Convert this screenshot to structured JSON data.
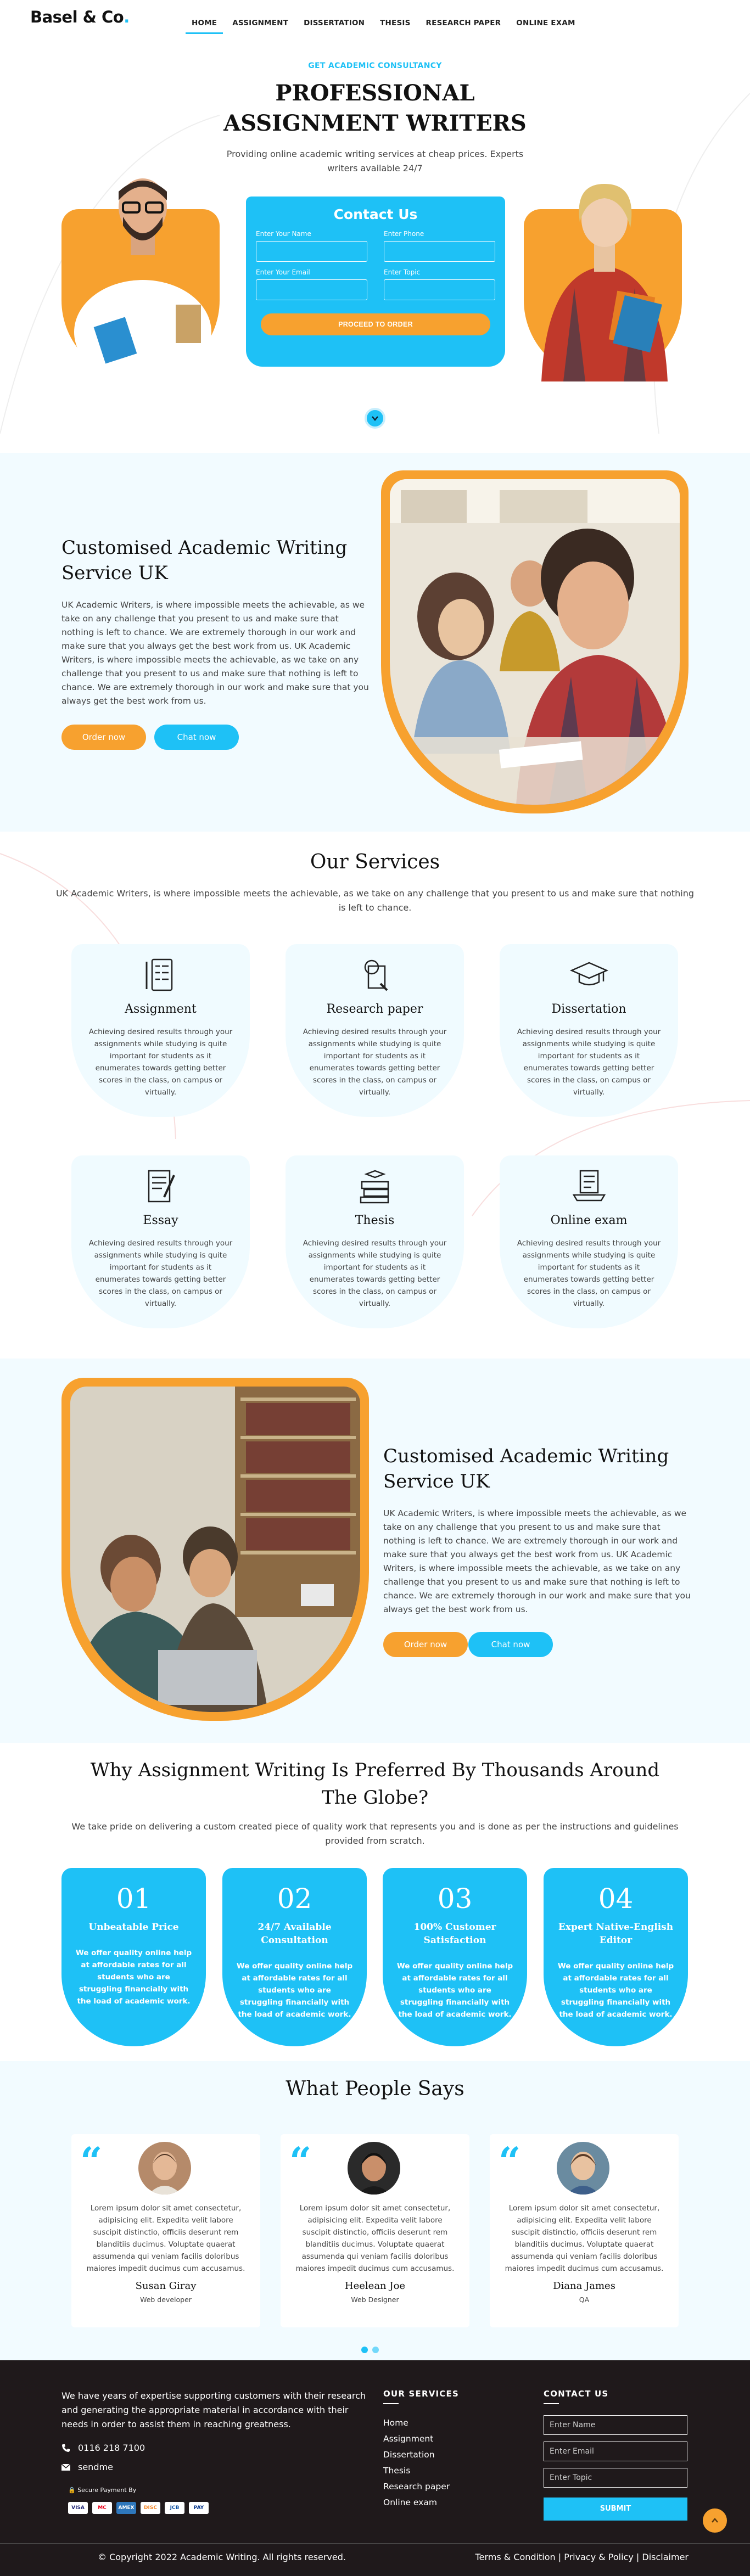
{
  "brand": {
    "name": "Basel & Co",
    "dot": "."
  },
  "nav": [
    {
      "label": "HOME",
      "active": true
    },
    {
      "label": "ASSIGNMENT"
    },
    {
      "label": "DISSERTATION"
    },
    {
      "label": "THESIS"
    },
    {
      "label": "RESEARCH PAPER"
    },
    {
      "label": "ONLINE EXAM"
    }
  ],
  "hero": {
    "tag": "GET ACADEMIC CONSULTANCY",
    "title_line1": "PROFESSIONAL",
    "title_line2": "ASSIGNMENT WRITERS",
    "subtitle": "Providing online academic writing services at cheap prices. Experts writers available 24/7",
    "contact": {
      "title": "Contact Us",
      "name_label": "Enter Your Name",
      "phone_label": "Enter Phone",
      "email_label": "Enter Your Email",
      "topic_label": "Enter Topic",
      "button": "PROCEED TO ORDER"
    }
  },
  "about1": {
    "title": "Customised Academic Writing Service UK",
    "text": "UK Academic Writers, is where impossible meets the achievable, as we take on any challenge that you present to us and make sure that nothing is left to chance. We are extremely thorough in our work and make sure that you always get the best work from us. UK Academic Writers, is where impossible meets the achievable, as we take on any challenge that you present to us and make sure that nothing is left to chance. We are extremely thorough in our work and make sure that you always get the best work from us.",
    "order_btn": "Order now",
    "chat_btn": "Chat now"
  },
  "services": {
    "title": "Our Services",
    "subtitle": "UK Academic Writers, is where impossible meets the achievable, as we take on any challenge that you present to us and make sure that nothing is left to chance.",
    "items": [
      {
        "title": "Assignment",
        "icon": "checklist-icon",
        "text": "Achieving desired results through your assignments while studying is quite important for students as it enumerates towards getting better scores in the class, on campus or virtually."
      },
      {
        "title": "Research paper",
        "icon": "magnifier-paper-icon",
        "text": "Achieving desired results through your assignments while studying is quite important for students as it enumerates towards getting better scores in the class, on campus or virtually."
      },
      {
        "title": "Dissertation",
        "icon": "graduation-cap-icon",
        "text": "Achieving desired results through your assignments while studying is quite important for students as it enumerates towards getting better scores in the class, on campus or virtually."
      },
      {
        "title": "Essay",
        "icon": "essay-pen-icon",
        "text": "Achieving desired results through your assignments while studying is quite important for students as it enumerates towards getting better scores in the class, on campus or virtually."
      },
      {
        "title": "Thesis",
        "icon": "book-stack-icon",
        "text": "Achieving desired results through your assignments while studying is quite important for students as it enumerates towards getting better scores in the class, on campus or virtually."
      },
      {
        "title": "Online exam",
        "icon": "laptop-exam-icon",
        "text": "Achieving desired results through your assignments while studying is quite important for students as it enumerates towards getting better scores in the class, on campus or virtually."
      }
    ]
  },
  "about2": {
    "title": "Customised Academic Writing Service UK",
    "text": "UK Academic Writers, is where impossible meets the achievable, as we take on any challenge that you present to us and make sure that nothing is left to chance. We are extremely thorough in our work and make sure that you always get the best work from us. UK Academic Writers, is where impossible meets the achievable, as we take on any challenge that you present to us and make sure that nothing is left to chance. We are extremely thorough in our work and make sure that you always get the best work from us.",
    "order_btn": "Order now",
    "chat_btn": "Chat now"
  },
  "why": {
    "title": "Why Assignment Writing Is Preferred By Thousands Around The Globe?",
    "subtitle": "We take pride on delivering a custom created piece of quality work that represents you and is done as per the instructions and guidelines provided from scratch.",
    "items": [
      {
        "num": "01",
        "title": "Unbeatable Price",
        "text": "We offer quality online help at affordable rates for all students who are struggling financially with the load of academic work."
      },
      {
        "num": "02",
        "title": "24/7 Available Consultation",
        "text": "We offer quality online help at affordable rates for all students who are struggling financially with the load of academic work."
      },
      {
        "num": "03",
        "title": "100% Customer Satisfaction",
        "text": "We offer quality online help at affordable rates for all students who are struggling financially with the load of academic work."
      },
      {
        "num": "04",
        "title": "Expert Native-English Editor",
        "text": "We offer quality online help at affordable rates for all students who are struggling financially with the load of academic work."
      }
    ]
  },
  "testimonials": {
    "title": "What People Says",
    "items": [
      {
        "text": "Lorem ipsum dolor sit amet consectetur, adipisicing elit. Expedita velit labore suscipit distinctio, officiis deserunt rem blanditiis ducimus. Voluptate quaerat assumenda qui veniam facilis doloribus maiores impedit ducimus cum accusamus.",
        "name": "Susan Giray",
        "role": "Web developer"
      },
      {
        "text": "Lorem ipsum dolor sit amet consectetur, adipisicing elit. Expedita velit labore suscipit distinctio, officiis deserunt rem blanditiis ducimus. Voluptate quaerat assumenda qui veniam facilis doloribus maiores impedit ducimus cum accusamus.",
        "name": "Heelean Joe",
        "role": "Web Designer"
      },
      {
        "text": "Lorem ipsum dolor sit amet consectetur, adipisicing elit. Expedita velit labore suscipit distinctio, officiis deserunt rem blanditiis ducimus. Voluptate quaerat assumenda qui veniam facilis doloribus maiores impedit ducimus cum accusamus.",
        "name": "Diana James",
        "role": "QA"
      }
    ]
  },
  "footer": {
    "about": "We have years of expertise supporting customers with their research and generating the appropriate material in accordance with their needs in order to assist them in reaching greatness.",
    "phone": "0116 218 7100",
    "email": "sendme",
    "secure": "Secure Payment By",
    "cards": [
      "VISA",
      "MC",
      "AMEX",
      "DISC",
      "JCB",
      "PAY"
    ],
    "services_title": "OUR SERVICES",
    "links": [
      "Home",
      "Assignment",
      "Dissertation",
      "Thesis",
      "Research paper",
      "Online exam"
    ],
    "contact_title": "CONTACT US",
    "inputs": [
      "Enter Name",
      "Enter Email",
      "Enter Topic"
    ],
    "submit": "SUBMIT",
    "copyright": "© Copyright 2022 Academic Writing. All rights reserved.",
    "legal": "Terms & Condition | Privacy & Policy | Disclaimer"
  },
  "colors": {
    "accent": "#1ec1f6",
    "orange": "#f7a12f",
    "dark": "#1f191b"
  }
}
